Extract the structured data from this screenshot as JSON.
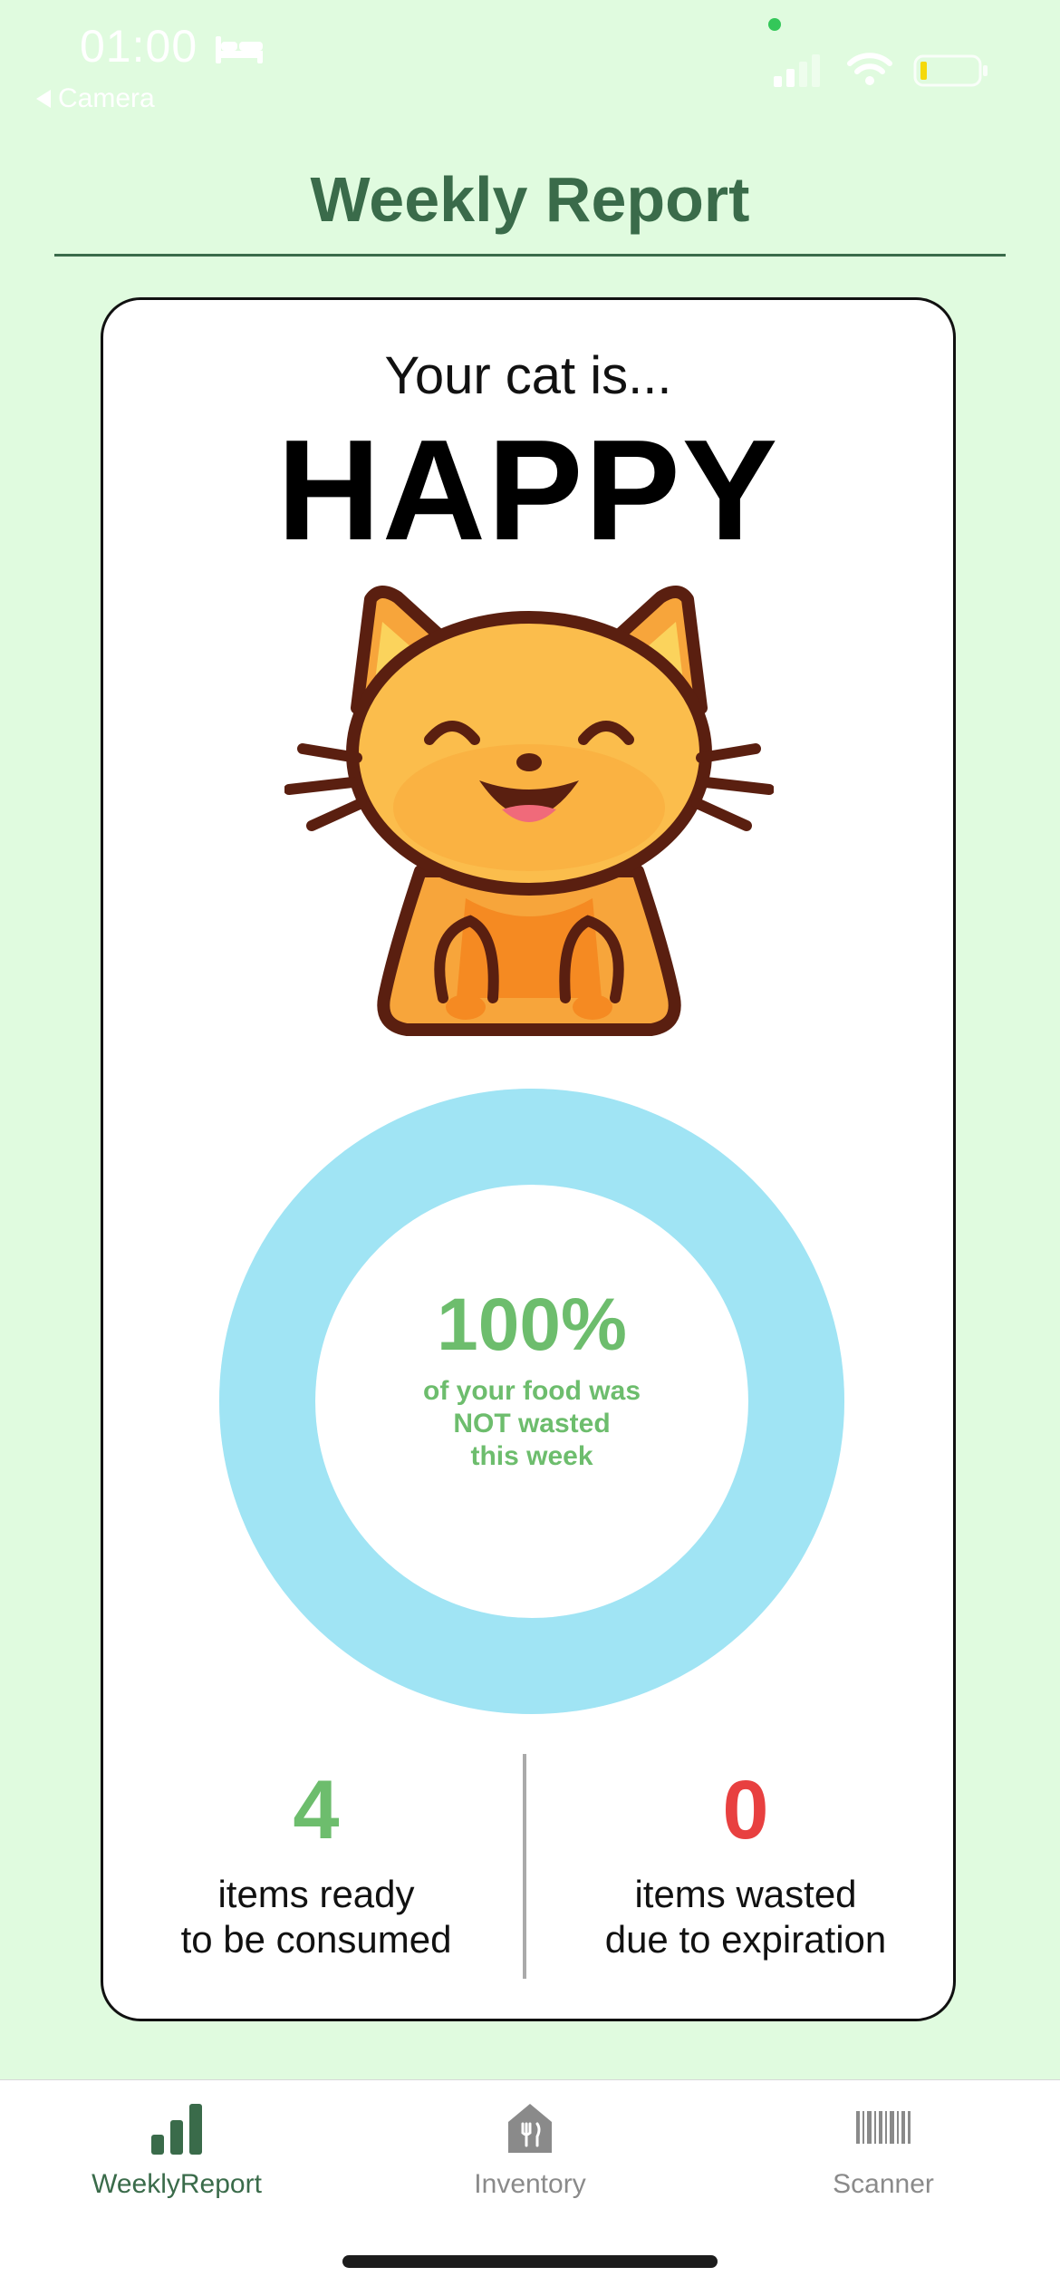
{
  "status_bar": {
    "time": "01:00",
    "back_app": "Camera",
    "icons": [
      "bed-icon",
      "signal-icon",
      "wifi-icon",
      "battery-icon"
    ]
  },
  "header": {
    "title": "Weekly Report"
  },
  "card": {
    "intro": "Your cat is...",
    "mood": "HAPPY",
    "illustration": "happy-cat-icon",
    "donut": {
      "percent_label": "100%",
      "percent_value": 100,
      "caption_lines": [
        "of your food was",
        "NOT wasted",
        "this week"
      ],
      "ring_color": "#a0e4f4",
      "text_color": "#6dbd6d"
    },
    "stats": {
      "ready": {
        "value": "4",
        "line1": "items ready",
        "line2": "to be consumed",
        "color": "#6dbd6d"
      },
      "wasted": {
        "value": "0",
        "line1": "items wasted",
        "line2": "due to expiration",
        "color": "#e84040"
      }
    }
  },
  "tabs": [
    {
      "label": "WeeklyReport",
      "icon": "bar-chart-icon",
      "active": true
    },
    {
      "label": "Inventory",
      "icon": "pantry-icon",
      "active": false
    },
    {
      "label": "Scanner",
      "icon": "barcode-icon",
      "active": false
    }
  ],
  "colors": {
    "background": "#e0fbdf",
    "accent": "#3a6b4a",
    "inactive": "#8a8a8a"
  }
}
